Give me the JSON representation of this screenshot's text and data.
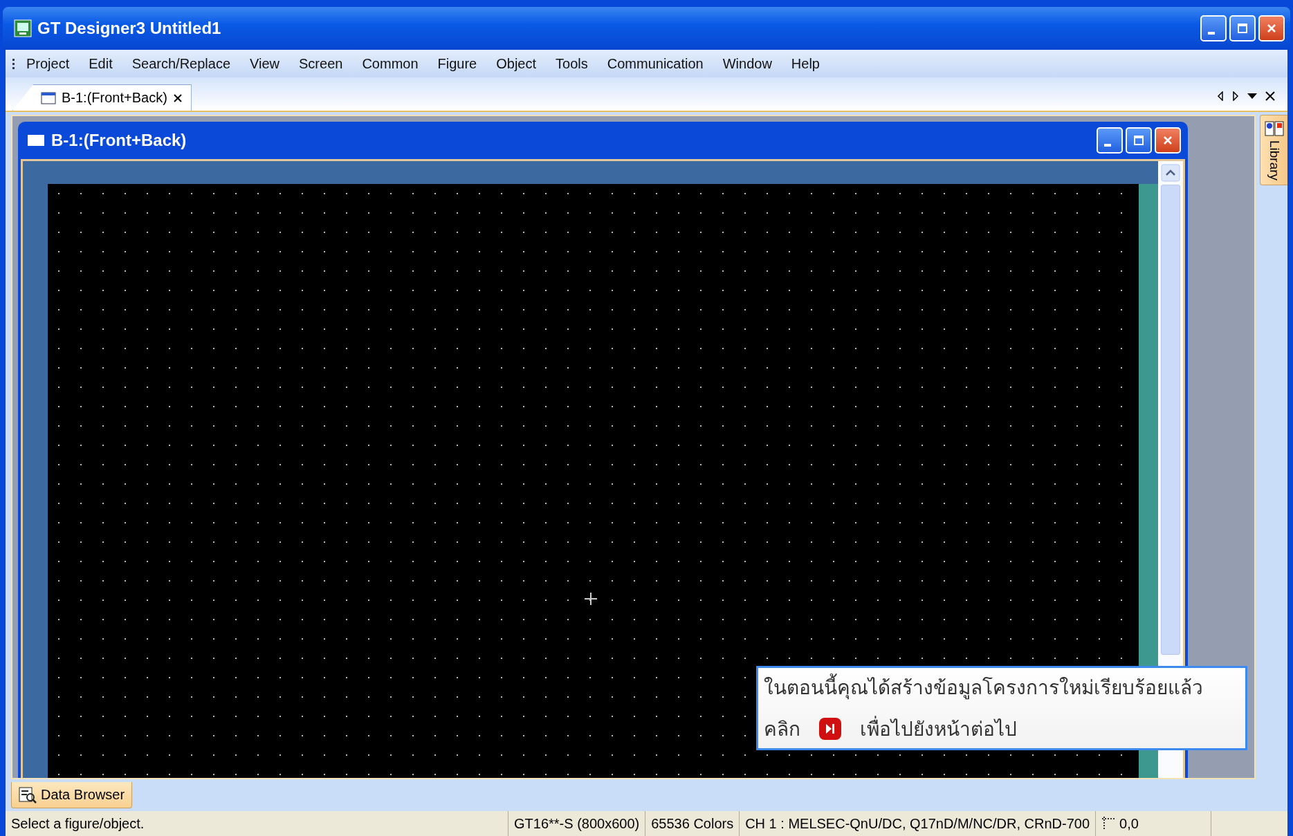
{
  "window": {
    "title": "GT Designer3 Untitled1"
  },
  "menu": [
    "Project",
    "Edit",
    "Search/Replace",
    "View",
    "Screen",
    "Common",
    "Figure",
    "Object",
    "Tools",
    "Communication",
    "Window",
    "Help"
  ],
  "document_tabs": [
    {
      "label": "B-1:(Front+Back)",
      "selected": true
    }
  ],
  "child_window": {
    "title": "B-1:(Front+Back)"
  },
  "side_tabs": [
    {
      "label": "Library"
    }
  ],
  "popup": {
    "message": "ในตอนนี้คุณได้สร้างข้อมูลโครงการใหม่เรียบร้อยแล้ว",
    "prefix": "คลิก",
    "suffix": "เพื่อไปยังหน้าต่อไป"
  },
  "bottom_tabs": [
    {
      "label": "Data Browser",
      "selected": true
    }
  ],
  "status_bar": [
    "Select a figure/object.",
    "GT16**-S (800x600)",
    "65536 Colors",
    "CH 1 : MELSEC-QnU/DC, Q17nD/M/NC/DR, CRnD-700",
    "0,0"
  ]
}
